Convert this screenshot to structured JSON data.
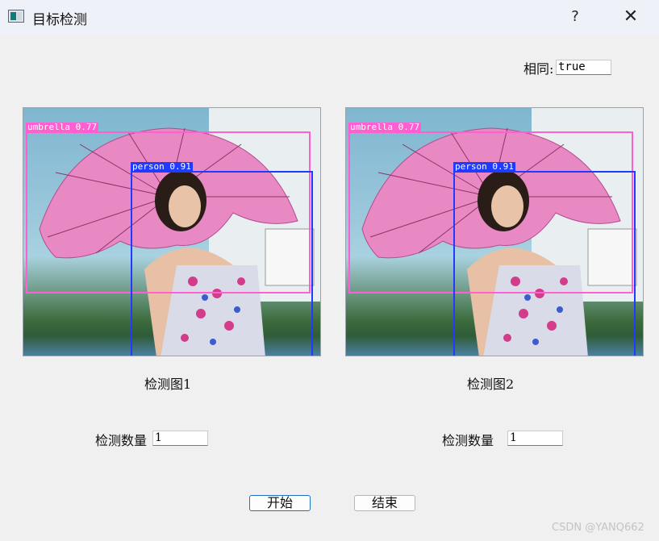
{
  "window": {
    "title": "目标检测",
    "help": "?",
    "close": "✕"
  },
  "same": {
    "label": "相同:",
    "value": "true"
  },
  "panels": [
    {
      "caption": "检测图1",
      "count_label": "检测数量",
      "count_value": "1",
      "detections": [
        {
          "label": "umbrella 0.77",
          "color": "#ff5fd0"
        },
        {
          "label": "person 0.91",
          "color": "#1f3bff"
        }
      ]
    },
    {
      "caption": "检测图2",
      "count_label": "检测数量",
      "count_value": "1",
      "detections": [
        {
          "label": "umbrella 0.77",
          "color": "#ff5fd0"
        },
        {
          "label": "person 0.91",
          "color": "#1f3bff"
        }
      ]
    }
  ],
  "buttons": {
    "start": "开始",
    "end": "结束"
  },
  "watermark": "CSDN @YANQ662"
}
